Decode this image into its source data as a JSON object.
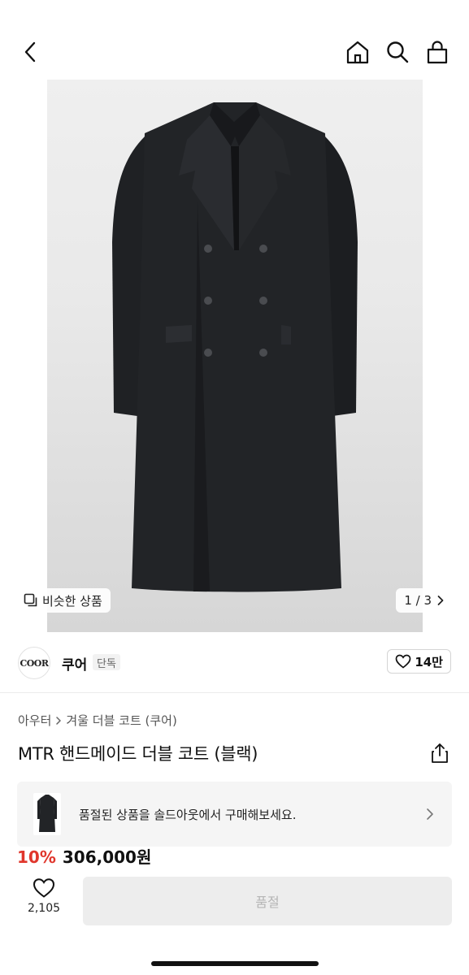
{
  "gallery": {
    "similar_label": "비슷한 상품",
    "counter": "1 / 3"
  },
  "brand": {
    "logo_text": "COOR",
    "name": "쿠어",
    "badge": "단독",
    "likes": "14만"
  },
  "breadcrumb": [
    "아우터",
    "겨울 더블 코트 (쿠어)"
  ],
  "product": {
    "title": "MTR 핸드메이드 더블 코트 (블랙)"
  },
  "soldout_banner": {
    "text": "품절된 상품을 솔드아웃에서 구매해보세요."
  },
  "price": {
    "discount": "10%",
    "amount": "306,000원"
  },
  "bottom": {
    "wish_count": "2,105",
    "buy_label": "품절"
  },
  "icons": [
    "back-icon",
    "home-icon",
    "search-icon",
    "shopping-bag-icon",
    "similar-items-icon",
    "chevron-right-icon",
    "heart-icon",
    "share-icon"
  ],
  "colors": {
    "discount": "#e0362c",
    "disabled_button": "#ededed",
    "coat": "#1f2124"
  }
}
